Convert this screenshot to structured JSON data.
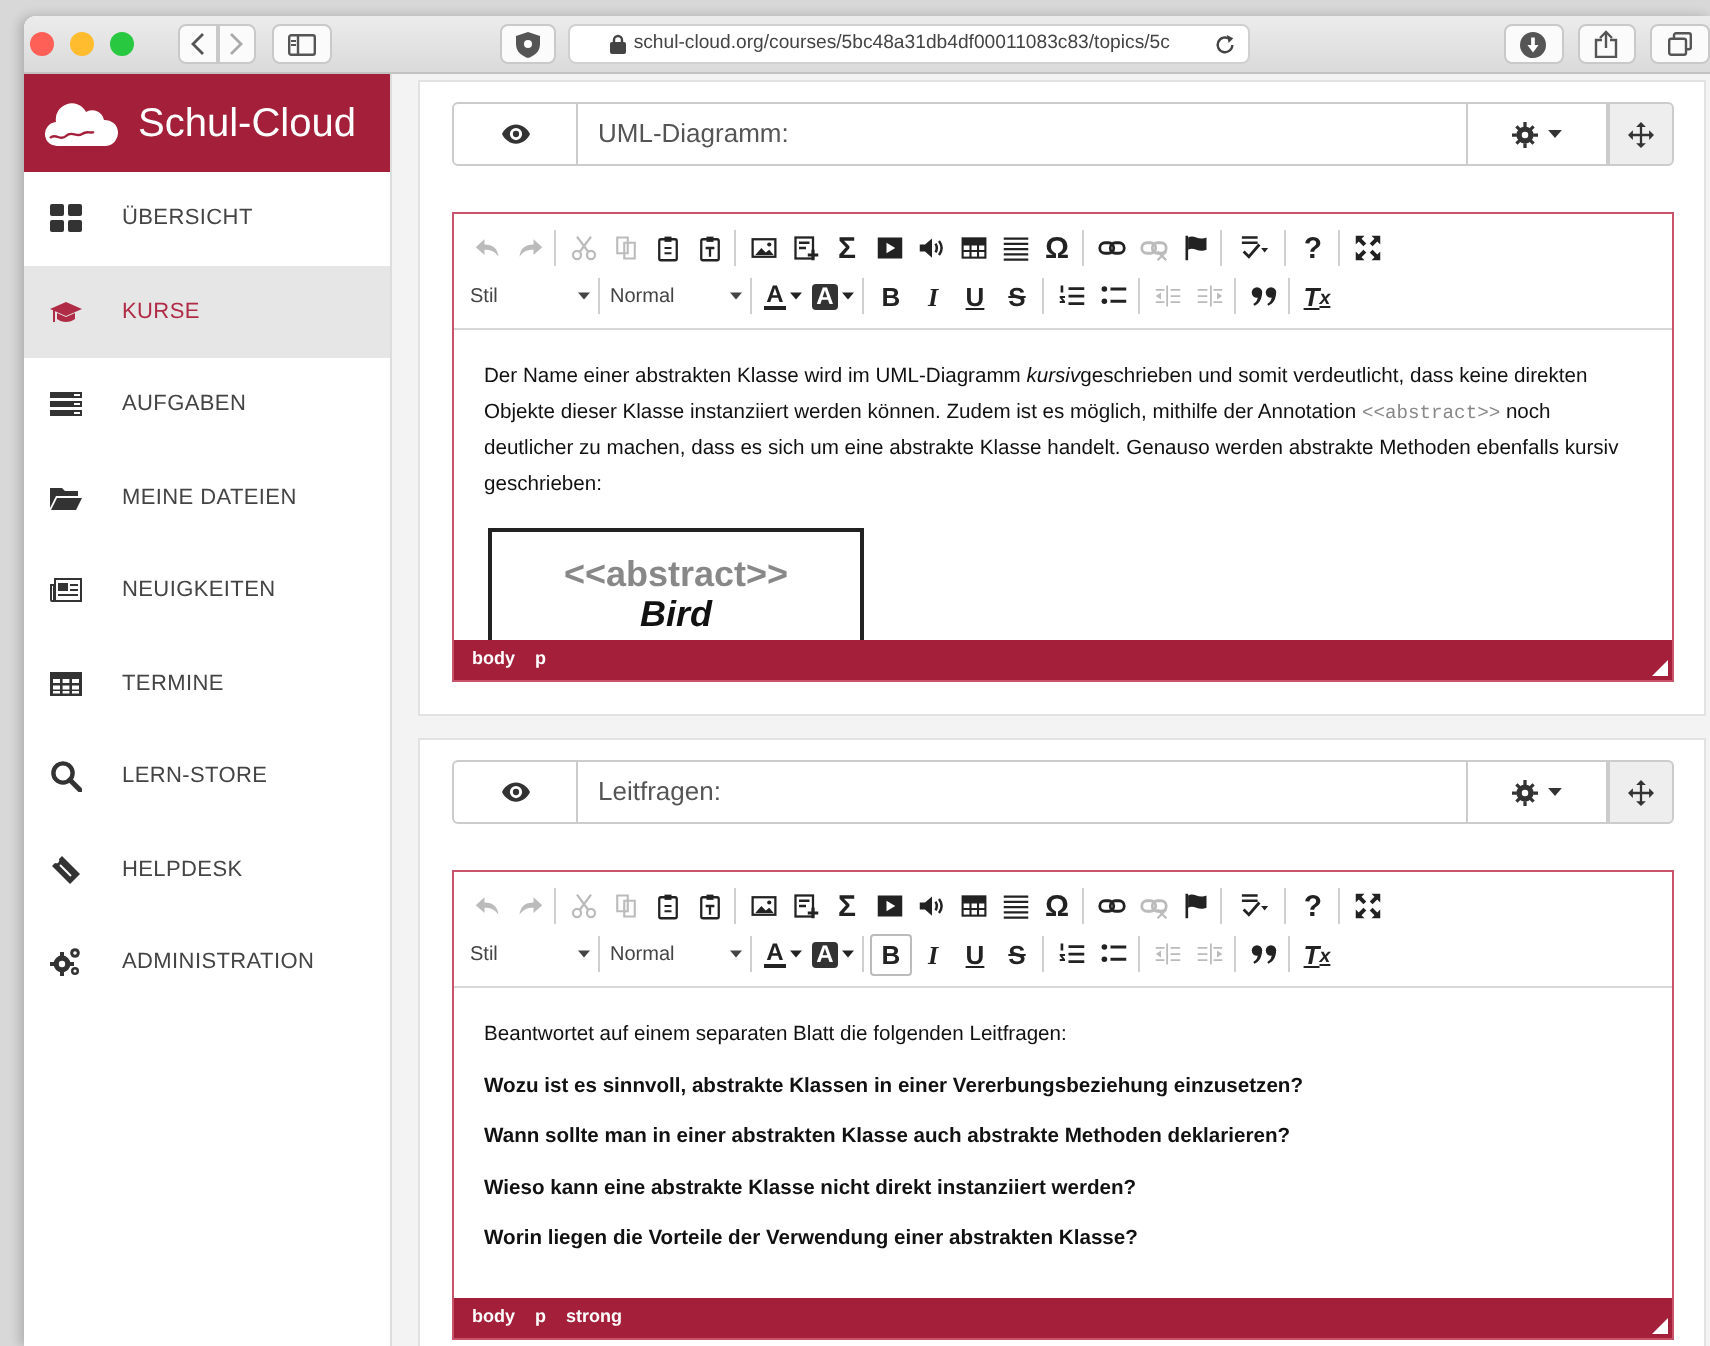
{
  "browser": {
    "url": "schul-cloud.org/courses/5bc48a31db4df00011083c83/topics/5c"
  },
  "sidebar": {
    "logo": "Schul-Cloud",
    "items": [
      {
        "label": "ÜBERSICHT",
        "selected": false
      },
      {
        "label": "KURSE",
        "selected": true
      },
      {
        "label": "AUFGABEN",
        "selected": false
      },
      {
        "label": "MEINE DATEIEN",
        "selected": false
      },
      {
        "label": "NEUIGKEITEN",
        "selected": false
      },
      {
        "label": "TERMINE",
        "selected": false
      },
      {
        "label": "LERN-STORE",
        "selected": false
      },
      {
        "label": "HELPDESK",
        "selected": false
      },
      {
        "label": "ADMINISTRATION",
        "selected": false
      }
    ]
  },
  "sections": [
    {
      "title": "UML-Diagramm:",
      "editor": {
        "toolbar": [
          {
            "groups": [
              [
                {
                  "kind": "icon",
                  "disabled": true
                },
                {
                  "kind": "icon",
                  "disabled": true
                }
              ],
              [
                {
                  "kind": "icon",
                  "disabled": true
                },
                {
                  "kind": "icon",
                  "disabled": true
                },
                {
                  "kind": "icon",
                  "disabled": false
                },
                {
                  "kind": "icon",
                  "disabled": false
                }
              ],
              [
                {
                  "kind": "icon",
                  "disabled": false
                },
                {
                  "kind": "icon",
                  "disabled": false
                },
                {
                  "kind": "glyph",
                  "label": "Σ"
                },
                {
                  "kind": "icon",
                  "disabled": false
                },
                {
                  "kind": "icon",
                  "disabled": false
                },
                {
                  "kind": "icon",
                  "disabled": false
                },
                {
                  "kind": "icon",
                  "disabled": false
                },
                {
                  "kind": "glyph",
                  "label": "Ω"
                }
              ],
              [
                {
                  "kind": "icon",
                  "disabled": false
                },
                {
                  "kind": "icon",
                  "disabled": true
                },
                {
                  "kind": "icon",
                  "disabled": false
                }
              ],
              [
                {
                  "kind": "icon",
                  "disabled": false
                }
              ],
              [
                {
                  "kind": "glyph",
                  "label": "?"
                }
              ],
              [
                {
                  "kind": "icon",
                  "disabled": false
                }
              ]
            ]
          },
          {
            "groups": [
              [
                {
                  "kind": "combo",
                  "label": "Stil"
                }
              ],
              [
                {
                  "kind": "combo",
                  "label": "Normal"
                }
              ],
              [
                {
                  "kind": "color",
                  "label": "A"
                },
                {
                  "kind": "bgcolor",
                  "label": "A"
                }
              ],
              [
                {
                  "kind": "format",
                  "label": "B",
                  "selected": false
                },
                {
                  "kind": "format",
                  "label": "I",
                  "selected": false
                },
                {
                  "kind": "format",
                  "label": "U",
                  "selected": false
                },
                {
                  "kind": "format",
                  "label": "S",
                  "selected": false
                }
              ],
              [
                {
                  "kind": "icon",
                  "disabled": false
                },
                {
                  "kind": "icon",
                  "disabled": false
                }
              ],
              [
                {
                  "kind": "icon",
                  "disabled": true
                },
                {
                  "kind": "icon",
                  "disabled": true
                }
              ],
              [
                {
                  "kind": "icon",
                  "disabled": false
                }
              ],
              [
                {
                  "kind": "clear",
                  "label": "T$_{x}$"
                }
              ]
            ]
          }
        ],
        "content": [
          {
            "kind": "paragraph",
            "bold": false,
            "parts": [
              {
                "kind": "text",
                "text": "Der Name einer abstrakten Klasse wird im UML-Diagramm "
              },
              {
                "kind": "italic",
                "text": "kursiv"
              },
              {
                "kind": "text",
                "text": "geschrieben und somit verdeutlicht, dass keine direkten Objekte dieser Klasse instanziiert werden können. Zudem ist es möglich, mithilfe der Annotation "
              },
              {
                "kind": "code",
                "text": "<<abstract>>"
              },
              {
                "kind": "text",
                "text": " noch deutlicher zu machen, dass es sich um eine abstrakte Klasse handelt. Genauso werden abstrakte Methoden ebenfalls kursiv geschrieben:"
              }
            ]
          },
          {
            "kind": "uml",
            "stereotype": "<<abstract>>",
            "name": "Bird"
          }
        ],
        "path": [
          "body",
          "p"
        ]
      }
    },
    {
      "title": "Leitfragen:",
      "editor": {
        "toolbar": [
          {
            "groups": [
              [
                {
                  "kind": "icon",
                  "disabled": true
                },
                {
                  "kind": "icon",
                  "disabled": true
                }
              ],
              [
                {
                  "kind": "icon",
                  "disabled": true
                },
                {
                  "kind": "icon",
                  "disabled": true
                },
                {
                  "kind": "icon",
                  "disabled": false
                },
                {
                  "kind": "icon",
                  "disabled": false
                }
              ],
              [
                {
                  "kind": "icon",
                  "disabled": false
                },
                {
                  "kind": "icon",
                  "disabled": false
                },
                {
                  "kind": "glyph",
                  "label": "Σ"
                },
                {
                  "kind": "icon",
                  "disabled": false
                },
                {
                  "kind": "icon",
                  "disabled": false
                },
                {
                  "kind": "icon",
                  "disabled": false
                },
                {
                  "kind": "icon",
                  "disabled": false
                },
                {
                  "kind": "glyph",
                  "label": "Ω"
                }
              ],
              [
                {
                  "kind": "icon",
                  "disabled": false
                },
                {
                  "kind": "icon",
                  "disabled": true
                },
                {
                  "kind": "icon",
                  "disabled": false
                }
              ],
              [
                {
                  "kind": "icon",
                  "disabled": false
                }
              ],
              [
                {
                  "kind": "glyph",
                  "label": "?"
                }
              ],
              [
                {
                  "kind": "icon",
                  "disabled": false
                }
              ]
            ]
          },
          {
            "groups": [
              [
                {
                  "kind": "combo",
                  "label": "Stil"
                }
              ],
              [
                {
                  "kind": "combo",
                  "label": "Normal"
                }
              ],
              [
                {
                  "kind": "color",
                  "label": "A"
                },
                {
                  "kind": "bgcolor",
                  "label": "A"
                }
              ],
              [
                {
                  "kind": "format",
                  "label": "B",
                  "selected": true
                },
                {
                  "kind": "format",
                  "label": "I",
                  "selected": false
                },
                {
                  "kind": "format",
                  "label": "U",
                  "selected": false
                },
                {
                  "kind": "format",
                  "label": "S",
                  "selected": false
                }
              ],
              [
                {
                  "kind": "icon",
                  "disabled": false
                },
                {
                  "kind": "icon",
                  "disabled": false
                }
              ],
              [
                {
                  "kind": "icon",
                  "disabled": true
                },
                {
                  "kind": "icon",
                  "disabled": true
                }
              ],
              [
                {
                  "kind": "icon",
                  "disabled": false
                }
              ],
              [
                {
                  "kind": "clear",
                  "label": "T$_{x}$"
                }
              ]
            ]
          }
        ],
        "content": [
          {
            "kind": "paragraph",
            "bold": false,
            "parts": [
              {
                "kind": "text",
                "text": "Beantwortet auf einem separaten Blatt die folgenden Leitfragen:"
              }
            ]
          },
          {
            "kind": "paragraph",
            "bold": true,
            "parts": [
              {
                "kind": "text",
                "text": "Wozu ist es sinnvoll, abstrakte Klassen in einer Vererbungsbeziehung einzusetzen?"
              }
            ]
          },
          {
            "kind": "paragraph",
            "bold": true,
            "parts": [
              {
                "kind": "text",
                "text": "Wann sollte man in einer abstrakten Klasse auch abstrakte Methoden deklarieren?"
              }
            ]
          },
          {
            "kind": "paragraph",
            "bold": true,
            "parts": [
              {
                "kind": "text",
                "text": "Wieso kann eine abstrakte Klasse nicht direkt instanziiert werden?"
              }
            ]
          },
          {
            "kind": "paragraph",
            "bold": true,
            "parts": [
              {
                "kind": "text",
                "text": "Worin liegen die Vorteile der Verwendung einer abstrakten Klasse?"
              }
            ]
          }
        ],
        "path": [
          "body",
          "p",
          "strong"
        ]
      }
    }
  ]
}
